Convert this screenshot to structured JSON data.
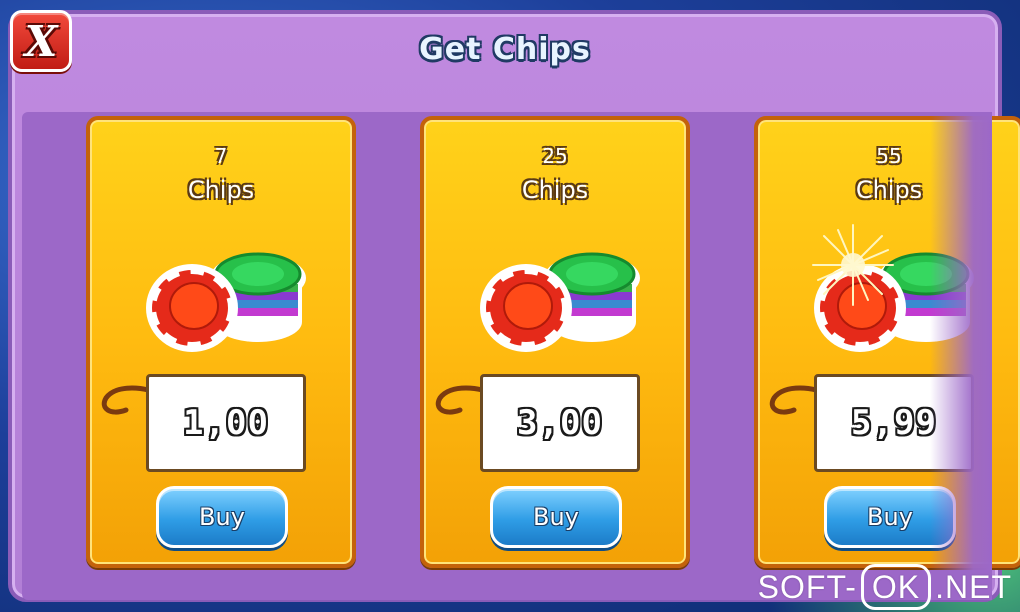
{
  "dialog": {
    "title": "Get Chips",
    "close_label": "X"
  },
  "packs": [
    {
      "amount": "7",
      "unit": "Chips",
      "price": "1,00",
      "buy_label": "Buy"
    },
    {
      "amount": "25",
      "unit": "Chips",
      "price": "3,00",
      "buy_label": "Buy"
    },
    {
      "amount": "55",
      "unit": "Chips",
      "price": "5,99",
      "buy_label": "Buy"
    }
  ],
  "watermark": {
    "left": "SOFT-",
    "box": "OK",
    "right": ".NET"
  },
  "colors": {
    "panel": "#b27fd6",
    "card": "#ffbb10",
    "buy_button": "#2f9de6",
    "close_button": "#d62a1e"
  }
}
